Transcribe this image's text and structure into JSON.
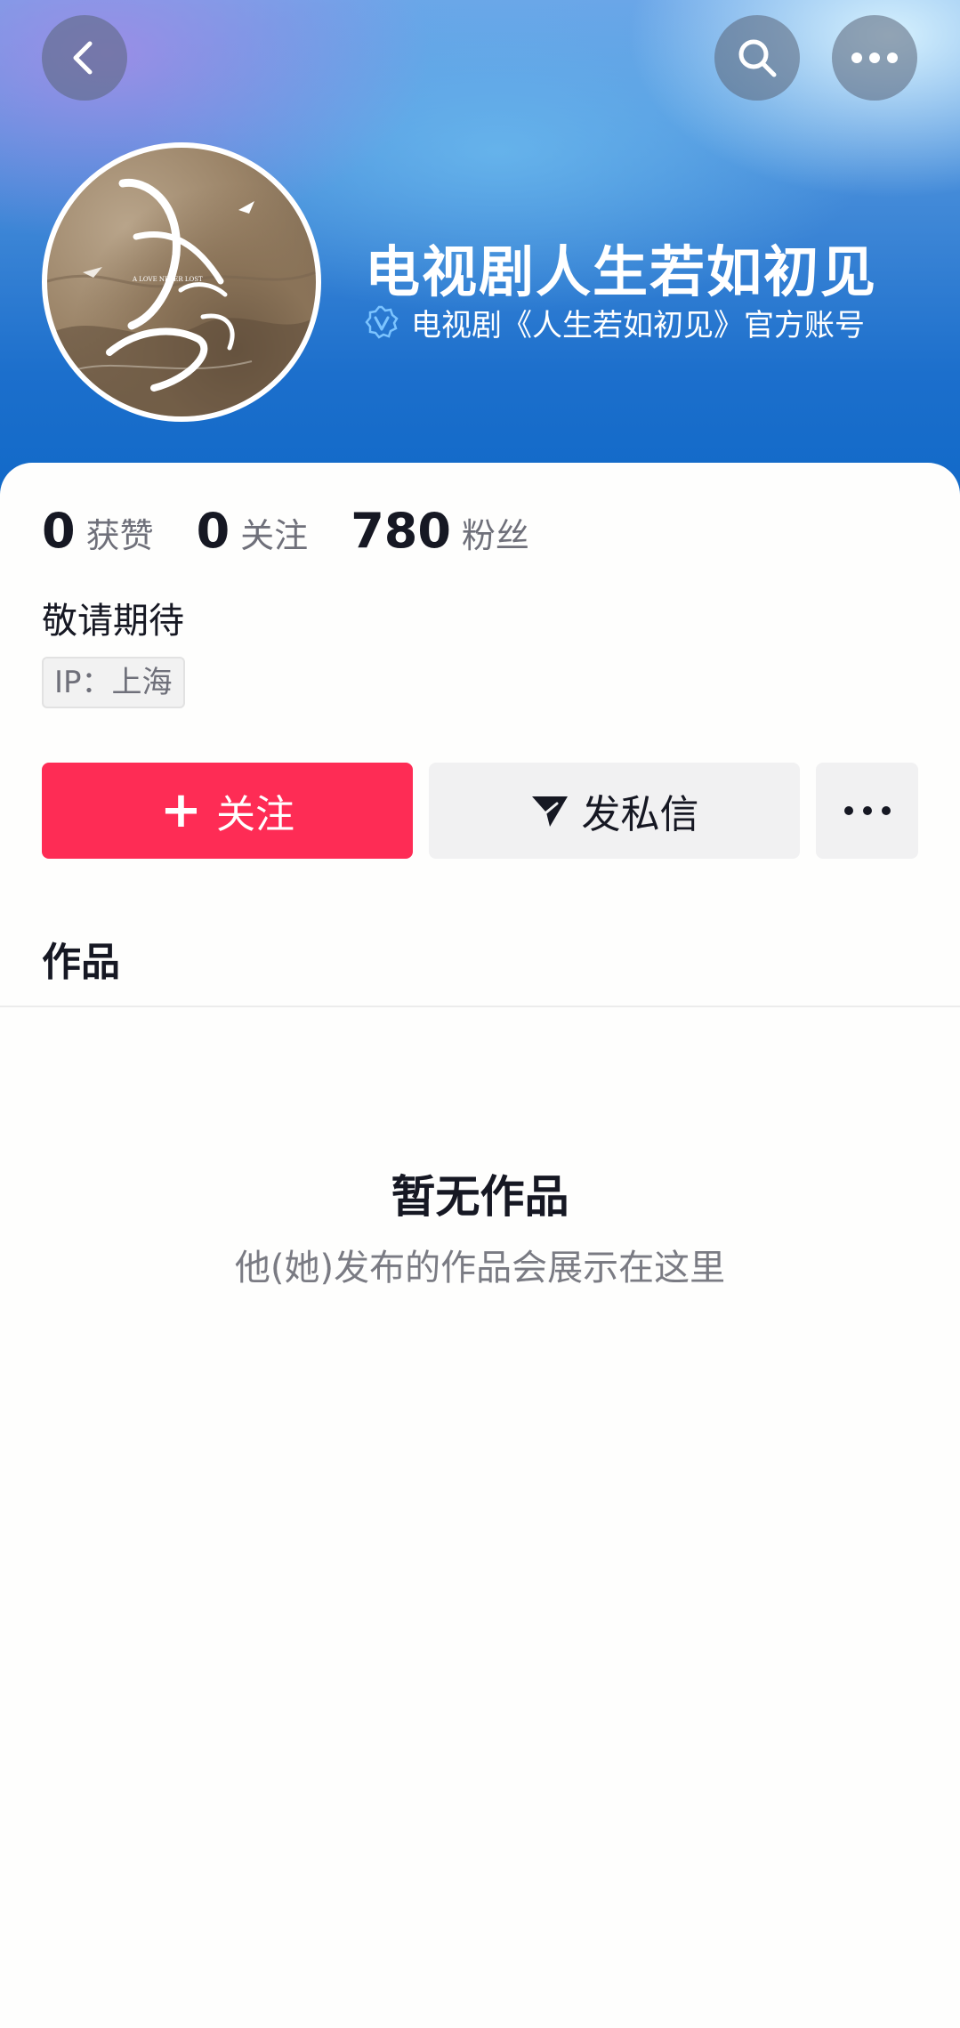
{
  "header": {
    "icons": {
      "back": "back-arrow-icon",
      "search": "search-icon",
      "more": "more-dots-icon"
    }
  },
  "profile": {
    "name": "电视剧人生若如初见",
    "verified_icon": "verified-badge-icon",
    "verification": "电视剧《人生若如初见》官方账号",
    "avatar_title": "人生若如初见",
    "avatar_subtitle": "A LOVE NEVER LOST"
  },
  "stats": [
    {
      "value": "0",
      "label": "获赞"
    },
    {
      "value": "0",
      "label": "关注"
    },
    {
      "value": "780",
      "label": "粉丝"
    }
  ],
  "bio": "敬请期待",
  "ip_tag": "IP：上海",
  "actions": {
    "follow_label": "关注",
    "follow_icon": "plus-icon",
    "message_label": "发私信",
    "message_icon": "send-icon",
    "more_icon": "more-dots-icon"
  },
  "tabs": {
    "works": "作品"
  },
  "empty_state": {
    "title": "暂无作品",
    "subtitle": "他(她)发布的作品会展示在这里"
  },
  "colors": {
    "follow_button": "#fe2c55",
    "banner_blue": "#1169c8",
    "text_primary": "#161823",
    "text_secondary": "#6f707a"
  }
}
